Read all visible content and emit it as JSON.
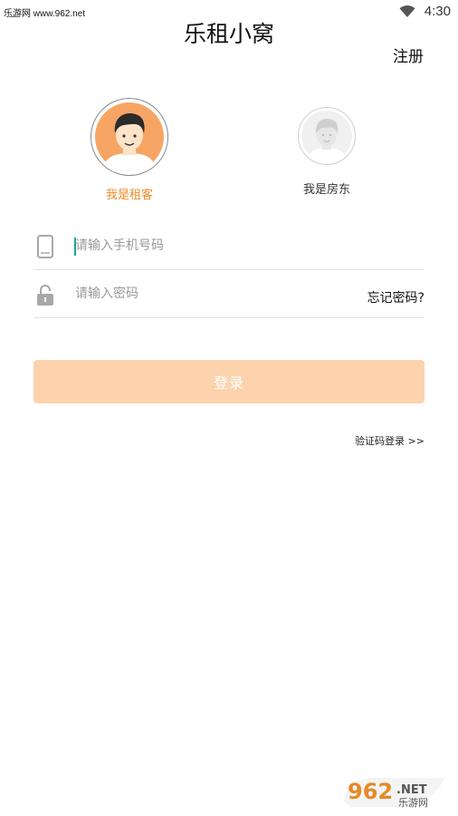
{
  "status_bar": {
    "watermark": "乐游网 www.962.net",
    "time": "4:30",
    "icons": [
      "wifi-icon"
    ]
  },
  "header": {
    "title": "乐租小窝",
    "register_label": "注册"
  },
  "roles": {
    "selected": "tenant",
    "tenant_label": "我是租客",
    "landlord_label": "我是房东"
  },
  "form": {
    "phone_placeholder": "请输入手机号码",
    "phone_value": "",
    "password_placeholder": "请输入密码",
    "password_value": "",
    "forgot_label": "忘记密码?",
    "icons": [
      "phone-icon",
      "lock-icon"
    ]
  },
  "actions": {
    "login_label": "登录",
    "sms_login_label": "验证码登录 >>"
  },
  "colors": {
    "accent": "#ef8c2a",
    "login_button_bg": "#fcd3ad",
    "tenant_avatar_bg": "#f7a564",
    "caret": "#1aa39a"
  },
  "watermark": {
    "number": "962",
    "suffix": ".NET",
    "site_name": "乐游网"
  }
}
